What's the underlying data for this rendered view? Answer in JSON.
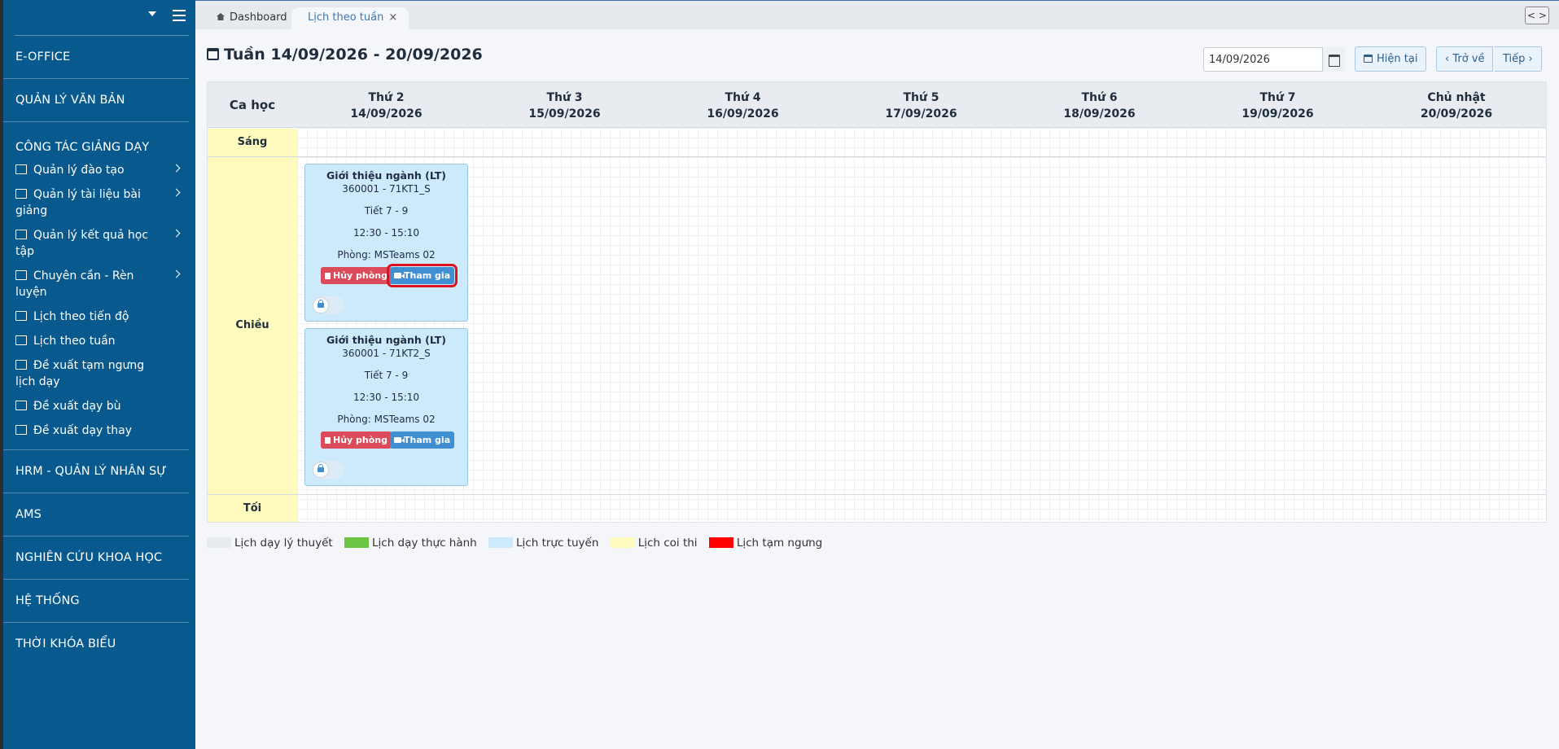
{
  "sidebar": {
    "sections": {
      "eoffice": "E-OFFICE",
      "van_ban": "QUẢN LÝ VĂN BẢN",
      "giang_day": "CÔNG TÁC GIẢNG DẠY",
      "hrm": "HRM - QUẢN LÝ NHÂN SỰ",
      "ams": "AMS",
      "nckh": "NGHIÊN CỨU KHOA HỌC",
      "he_thong": "HỆ THỐNG",
      "tkb": "THỜI KHÓA BIỂU"
    },
    "items": [
      {
        "label": "Quản lý đào tạo",
        "icon": "monitor-icon"
      },
      {
        "label": "Quản lý tài liệu bài giảng",
        "icon": "book-icon"
      },
      {
        "label": "Quản lý kết quả học tập",
        "icon": "calendar-grid-icon"
      },
      {
        "label": "Chuyên cần - Rèn luyện",
        "icon": "book-icon"
      },
      {
        "label": "Lịch theo tiến độ",
        "icon": "calendar-check-icon"
      },
      {
        "label": "Lịch theo tuần",
        "icon": "calendar-grid-icon"
      },
      {
        "label": "Đề xuất tạm ngưng lịch dạy",
        "icon": "calendar-minus-icon"
      },
      {
        "label": "Đề xuất dạy bù",
        "icon": "calendar-plus-icon"
      },
      {
        "label": "Đề xuất dạy thay",
        "icon": "calendar-plus-icon"
      }
    ]
  },
  "tabs": {
    "dashboard": "Dashboard",
    "active": "Lịch theo tuần",
    "close": "×"
  },
  "header": {
    "week_title": "Tuần 14/09/2026 - 20/09/2026",
    "date_value": "14/09/2026",
    "btn_now": "Hiện tại",
    "btn_prev": "‹ Trở về",
    "btn_next": "Tiếp ›"
  },
  "grid": {
    "ca_hoc": "Ca học",
    "days": [
      {
        "name": "Thứ 2",
        "date": "14/09/2026"
      },
      {
        "name": "Thứ 3",
        "date": "15/09/2026"
      },
      {
        "name": "Thứ 4",
        "date": "16/09/2026"
      },
      {
        "name": "Thứ 5",
        "date": "17/09/2026"
      },
      {
        "name": "Thứ 6",
        "date": "18/09/2026"
      },
      {
        "name": "Thứ 7",
        "date": "19/09/2026"
      },
      {
        "name": "Chủ nhật",
        "date": "20/09/2026"
      }
    ],
    "sessions": {
      "sang": "Sáng",
      "chieu": "Chiều",
      "toi": "Tối"
    }
  },
  "events": [
    {
      "title": "Giới thiệu ngành (LT)",
      "code": "360001 - 71KT1_S",
      "tiet": "Tiết 7 - 9",
      "time": "12:30 - 15:10",
      "room": "Phòng: MSTeams 02",
      "cancel_label": "Hủy phòng",
      "join_label": "Tham gia"
    },
    {
      "title": "Giới thiệu ngành (LT)",
      "code": "360001 - 71KT2_S",
      "tiet": "Tiết 7 - 9",
      "time": "12:30 - 15:10",
      "room": "Phòng: MSTeams 02",
      "cancel_label": "Hủy phòng",
      "join_label": "Tham gia"
    }
  ],
  "legend": [
    {
      "label": "Lịch dạy lý thuyết",
      "color": "#e8ebf0"
    },
    {
      "label": "Lịch dạy thực hành",
      "color": "#6cc644"
    },
    {
      "label": "Lịch trực tuyến",
      "color": "#cdeafc"
    },
    {
      "label": "Lịch coi thi",
      "color": "#fffbbf"
    },
    {
      "label": "Lịch tạm ngưng",
      "color": "#ff0000"
    }
  ],
  "colors": {
    "sidebar_bg": "#085a8e",
    "cancel_button": "#dc4b5a",
    "join_button": "#3f8fd2",
    "online_card": "#cdeafc",
    "highlight": "#e0101c"
  }
}
